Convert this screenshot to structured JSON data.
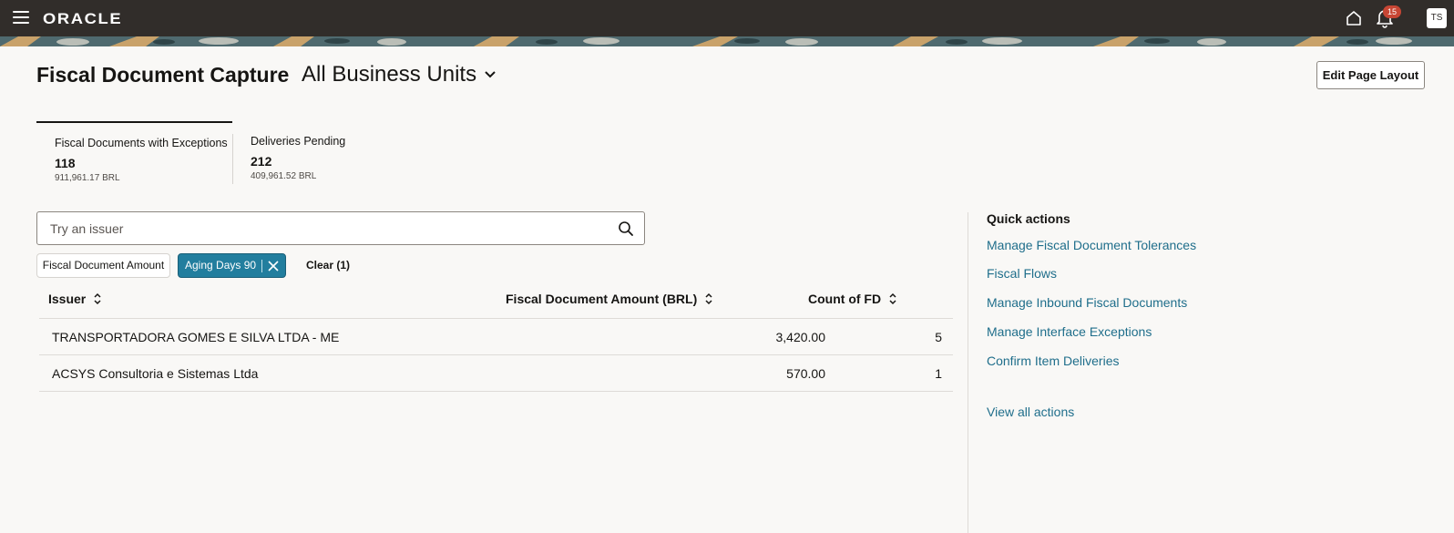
{
  "header": {
    "logo": "ORACLE",
    "notification_count": "15",
    "user_initials": "TS"
  },
  "page": {
    "title": "Fiscal Document Capture",
    "business_unit": "All Business Units",
    "edit_layout_label": "Edit Page Layout"
  },
  "metrics": [
    {
      "label": "Fiscal Documents with Exceptions",
      "count": "118",
      "amount": "911,961.17 BRL"
    },
    {
      "label": "Deliveries Pending",
      "count": "212",
      "amount": "409,961.52 BRL"
    }
  ],
  "search": {
    "placeholder": "Try an issuer"
  },
  "filters": {
    "chip1": "Fiscal Document Amount",
    "chip2": "Aging Days 90",
    "clear": "Clear (1)"
  },
  "table": {
    "columns": [
      "Issuer",
      "Fiscal Document Amount (BRL)",
      "Count of FD"
    ],
    "rows": [
      {
        "issuer": "TRANSPORTADORA GOMES E SILVA LTDA - ME",
        "amount": "3,420.00",
        "count": "5"
      },
      {
        "issuer": "ACSYS Consultoria e Sistemas Ltda",
        "amount": "570.00",
        "count": "1"
      }
    ]
  },
  "quick_actions": {
    "title": "Quick actions",
    "items": [
      "Manage Fiscal Document Tolerances",
      "Fiscal Flows",
      "Manage Inbound Fiscal Documents",
      "Manage Interface Exceptions",
      "Confirm Item Deliveries"
    ],
    "view_all": "View all actions"
  },
  "colors": {
    "topbar": "#312d2a",
    "accent_chip": "#227e9e",
    "link": "#1f6e8b",
    "badge": "#c74634"
  }
}
